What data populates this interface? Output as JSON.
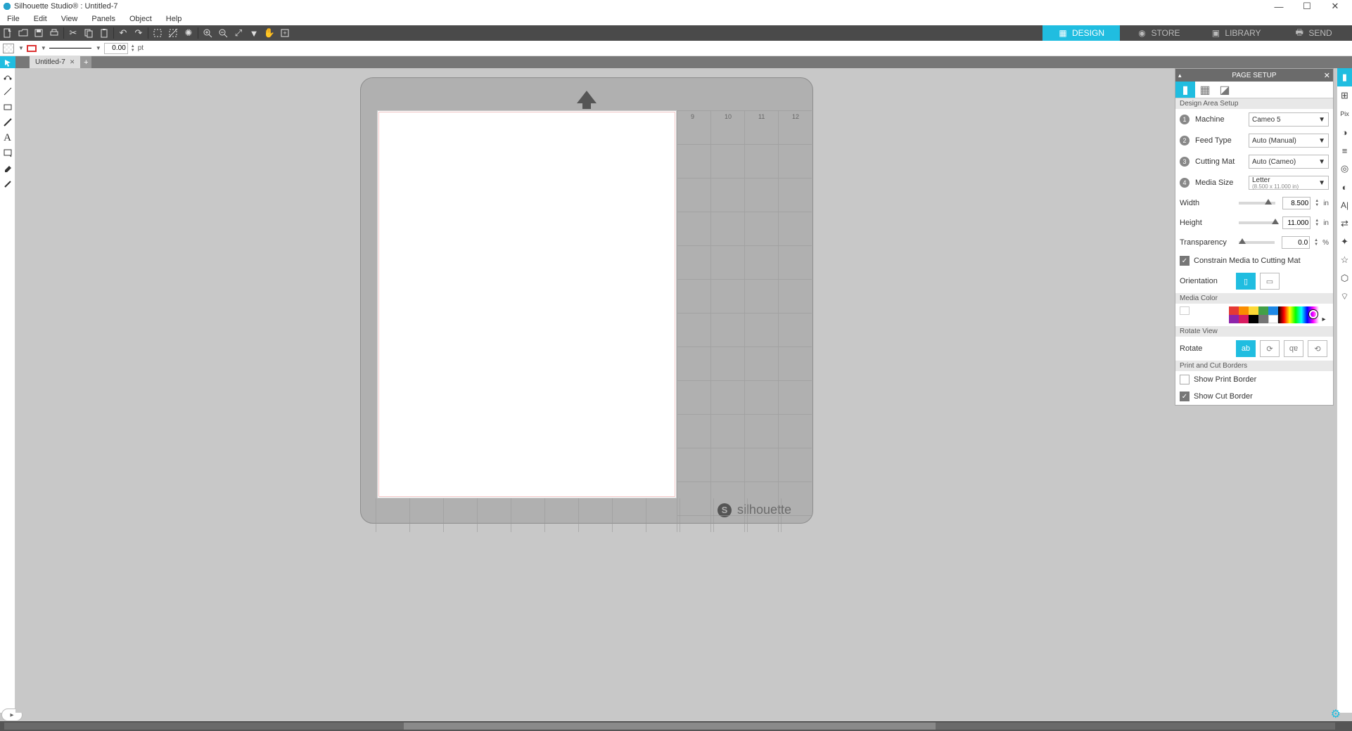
{
  "title": "Silhouette Studio® : Untitled-7",
  "window_buttons": {
    "min": "—",
    "max": "☐",
    "close": "✕"
  },
  "menu": [
    "File",
    "Edit",
    "View",
    "Panels",
    "Object",
    "Help"
  ],
  "modes": [
    {
      "label": "DESIGN",
      "active": true,
      "icon": "grid"
    },
    {
      "label": "STORE",
      "active": false,
      "icon": "globe"
    },
    {
      "label": "LIBRARY",
      "active": false,
      "icon": "folder"
    },
    {
      "label": "SEND",
      "active": false,
      "icon": "printer"
    }
  ],
  "line_value": "0.00",
  "line_unit": "pt",
  "tabs": [
    {
      "name": "Untitled-7"
    }
  ],
  "left_tools": [
    "select",
    "edit-points",
    "line",
    "rect",
    "draw",
    "text",
    "knife",
    "erase",
    "freehand"
  ],
  "right_tools": [
    "page-setup",
    "grid",
    "pixscan",
    "design-page",
    "align",
    "scale",
    "contrast",
    "text-style",
    "adjust",
    "sparkle",
    "star",
    "shapes",
    "color-picker"
  ],
  "panel": {
    "title": "PAGE SETUP",
    "section1": "Design Area Setup",
    "machine_label": "Machine",
    "machine": "Cameo 5",
    "feed_label": "Feed Type",
    "feed": "Auto (Manual)",
    "mat_label": "Cutting Mat",
    "mat": "Auto (Cameo)",
    "media_label": "Media Size",
    "media": "Letter",
    "media_sub": "(8.500 x 11.000 in)",
    "width_label": "Width",
    "width": "8.500",
    "width_unit": "in",
    "height_label": "Height",
    "height": "11.000",
    "height_unit": "in",
    "transparency_label": "Transparency",
    "transparency": "0.0",
    "transparency_unit": "%",
    "constrain_label": "Constrain Media to Cutting Mat",
    "constrain": true,
    "orientation_label": "Orientation",
    "section2": "Media Color",
    "section3": "Rotate View",
    "rotate_label": "Rotate",
    "section4": "Print and Cut Borders",
    "show_print_label": "Show Print Border",
    "show_print": false,
    "show_cut_label": "Show Cut Border",
    "show_cut": true,
    "colors": [
      "#ffffff",
      "#e53935",
      "#fb8c00",
      "#fdd835",
      "#43a047",
      "#1e88e5",
      "#8e24aa",
      "#d81b60",
      "#000000",
      "#757575"
    ]
  },
  "brand": "silhouette",
  "ruler": [
    "9",
    "10",
    "11",
    "12"
  ]
}
